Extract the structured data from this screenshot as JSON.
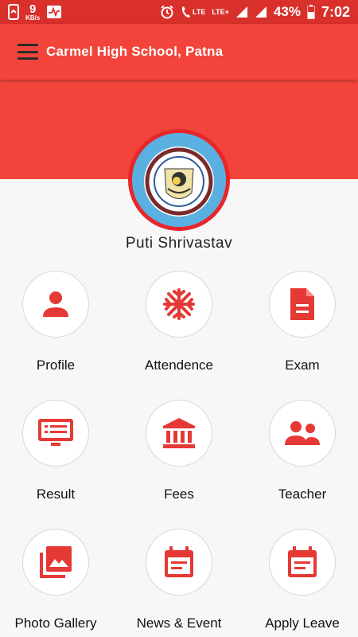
{
  "statusbar": {
    "speed_value": "9",
    "speed_unit": "KB/s",
    "lte_label_1": "LTE",
    "lte_label_2": "LTE+",
    "battery": "43%",
    "time": "7:02"
  },
  "appbar": {
    "title": "Carmel High School, Patna"
  },
  "student": {
    "name": "Puti Shrivastav"
  },
  "colors": {
    "primary": "#f2443a",
    "status": "#d9302b",
    "icon": "#e53935"
  },
  "menu": [
    {
      "label": "Profile",
      "icon": "person-icon"
    },
    {
      "label": "Attendence",
      "icon": "asterisk-icon"
    },
    {
      "label": "Exam",
      "icon": "document-icon"
    },
    {
      "label": "Result",
      "icon": "monitor-list-icon"
    },
    {
      "label": "Fees",
      "icon": "bank-icon"
    },
    {
      "label": "Teacher",
      "icon": "people-icon"
    },
    {
      "label": "Photo Gallery",
      "icon": "photo-library-icon"
    },
    {
      "label": "News & Event",
      "icon": "calendar-icon"
    },
    {
      "label": "Apply Leave",
      "icon": "calendar-icon"
    }
  ]
}
